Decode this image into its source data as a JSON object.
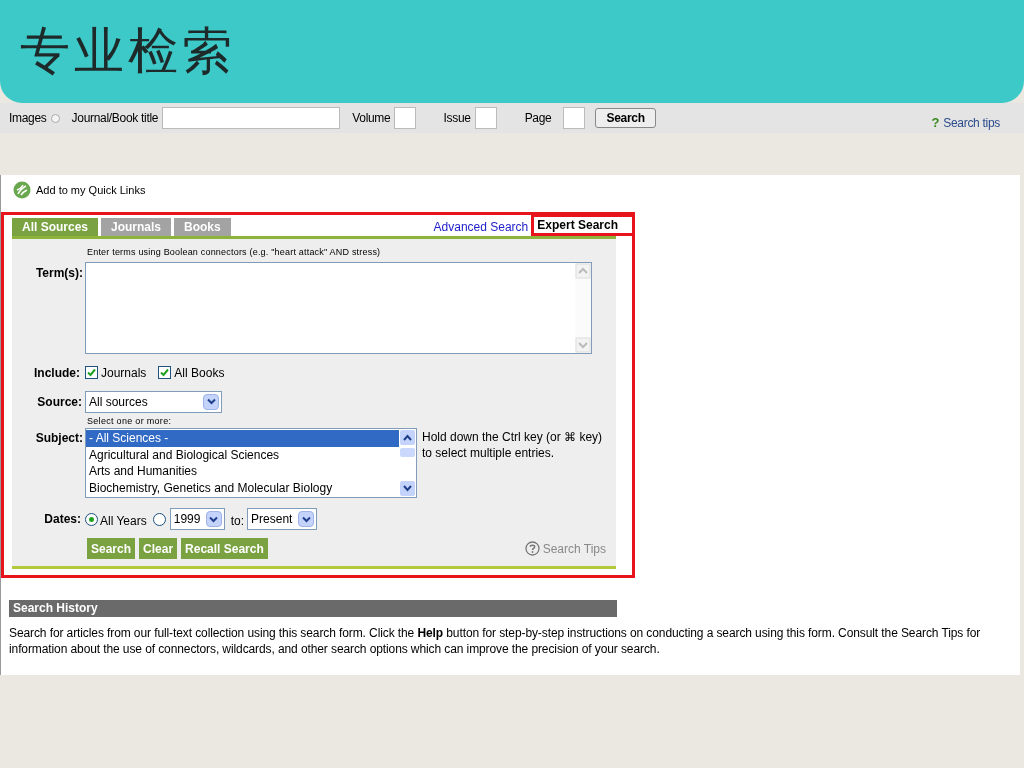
{
  "slide_title": "专业检索",
  "top_bar": {
    "images_label": "Images",
    "images_selected": false,
    "journal_label": "Journal/Book title",
    "volume_label": "Volume",
    "issue_label": "Issue",
    "page_label": "Page",
    "search_button": "Search",
    "tips_icon": "?",
    "tips_link": "Search tips"
  },
  "quick_links": "Add to my Quick Links",
  "tabs": [
    {
      "label": "All Sources",
      "selected": true
    },
    {
      "label": "Journals",
      "selected": false
    },
    {
      "label": "Books",
      "selected": false
    }
  ],
  "links": [
    {
      "label": "Advanced Search",
      "selected": false
    },
    {
      "label": "Expert Search",
      "selected": true
    }
  ],
  "hint": "Enter terms using Boolean connectors (e.g. \"heart attack\" AND stress)",
  "terms_label": "Term(s):",
  "include": {
    "label": "Include:",
    "options": [
      {
        "label": "Journals",
        "checked": true
      },
      {
        "label": "All Books",
        "checked": true
      }
    ]
  },
  "source": {
    "label": "Source:",
    "value": "All sources"
  },
  "subject": {
    "hint": "Select one or more:",
    "label": "Subject:",
    "items": [
      {
        "label": "- All Sciences -",
        "selected": true
      },
      {
        "label": "Agricultural and Biological Sciences",
        "selected": false
      },
      {
        "label": "Arts and Humanities",
        "selected": false
      },
      {
        "label": "Biochemistry, Genetics and Molecular Biology",
        "selected": false
      }
    ],
    "note": "Hold down the Ctrl key (or ⌘ key) to select multiple entries."
  },
  "dates": {
    "label": "Dates:",
    "all_years": {
      "label": "All Years",
      "selected": true
    },
    "range": {
      "selected": false,
      "from": "1999",
      "to_label": "to:",
      "to": "Present"
    }
  },
  "buttons": [
    "Search",
    "Clear",
    "Recall Search"
  ],
  "search_tips": "Search Tips",
  "history": {
    "title": "Search History",
    "text": "Search for articles from our full-text collection using this search form. Click the **Help** button for step-by-step instructions on conducting a search using this form. Consult the Search Tips for information about the use of connectors, wildcards, and other search options which can improve the precision of your search."
  }
}
